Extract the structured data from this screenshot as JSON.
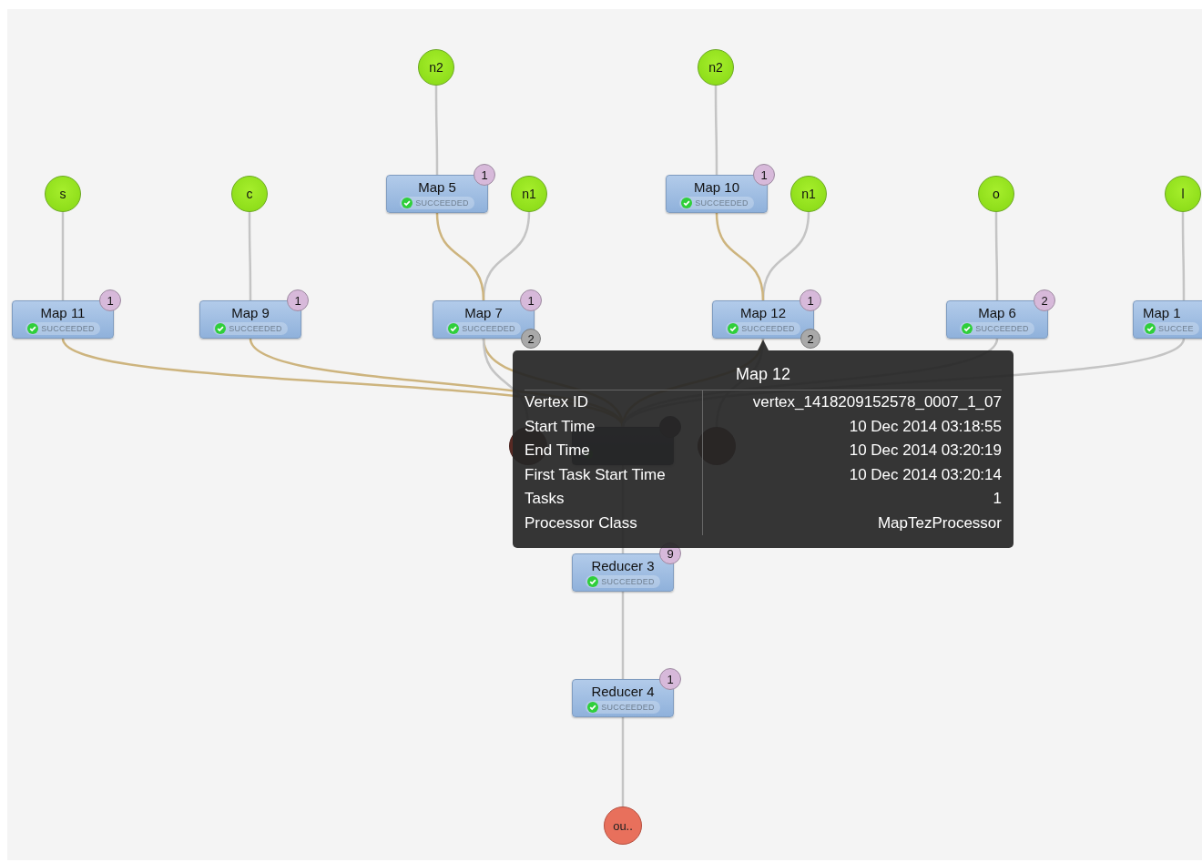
{
  "dag": {
    "sources": [
      {
        "label": "n2"
      },
      {
        "label": "n2"
      },
      {
        "label": "s"
      },
      {
        "label": "c"
      },
      {
        "label": "n1"
      },
      {
        "label": "n1"
      },
      {
        "label": "o"
      },
      {
        "label": "l"
      }
    ],
    "vertices": [
      {
        "name": "Map 5",
        "status": "SUCCEEDED",
        "tasks": "1"
      },
      {
        "name": "Map 10",
        "status": "SUCCEEDED",
        "tasks": "1"
      },
      {
        "name": "Map 11",
        "status": "SUCCEEDED",
        "tasks": "1"
      },
      {
        "name": "Map 9",
        "status": "SUCCEEDED",
        "tasks": "1"
      },
      {
        "name": "Map 7",
        "status": "SUCCEEDED",
        "tasks": "1",
        "inputs": "2"
      },
      {
        "name": "Map 12",
        "status": "SUCCEEDED",
        "tasks": "1",
        "inputs": "2"
      },
      {
        "name": "Map 6",
        "status": "SUCCEEDED",
        "tasks": "2"
      },
      {
        "name": "Map 1",
        "status": "SUCCEE"
      },
      {
        "kind": "covered"
      },
      {
        "name": "Reducer 3",
        "status": "SUCCEEDED",
        "tasks": "9"
      },
      {
        "name": "Reducer 4",
        "status": "SUCCEEDED",
        "tasks": "1"
      }
    ],
    "sinks": [
      {
        "kind": "covered"
      },
      {
        "kind": "covered"
      },
      {
        "kind": "plain",
        "label": "ou.."
      }
    ]
  },
  "tooltip": {
    "title": "Map 12",
    "rows": [
      {
        "label": "Vertex ID",
        "value": "vertex_1418209152578_0007_1_07"
      },
      {
        "label": "Start Time",
        "value": "10 Dec 2014 03:18:55"
      },
      {
        "label": "End Time",
        "value": "10 Dec 2014 03:20:19"
      },
      {
        "label": "First Task Start Time",
        "value": "10 Dec 2014 03:20:14"
      },
      {
        "label": "Tasks",
        "value": "1"
      },
      {
        "label": "Processor Class",
        "value": "MapTezProcessor"
      }
    ]
  }
}
